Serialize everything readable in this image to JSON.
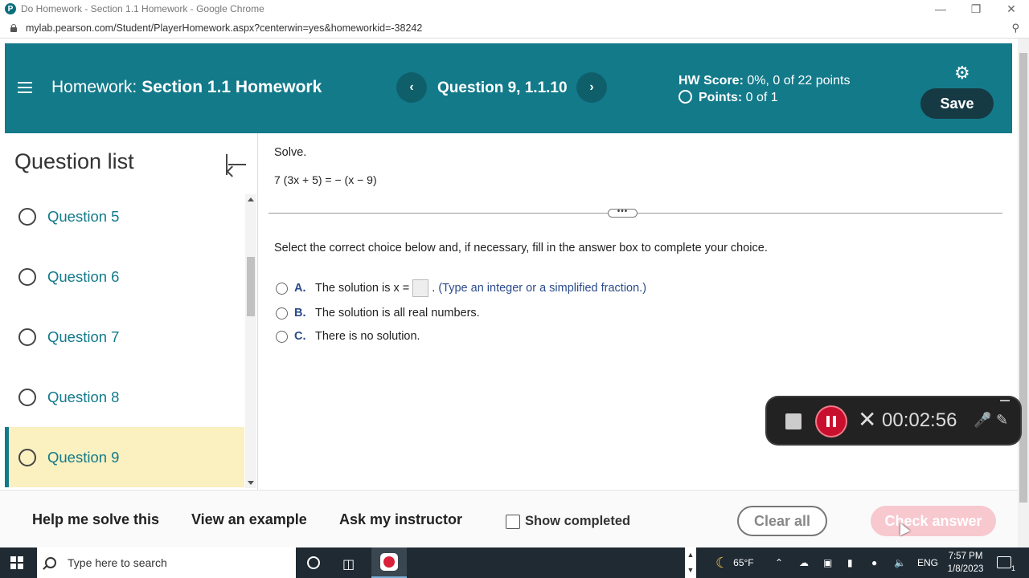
{
  "browser": {
    "window_title": "Do Homework - Section 1.1 Homework - Google Chrome",
    "url": "mylab.pearson.com/Student/PlayerHomework.aspx?centerwin=yes&homeworkid=-38242"
  },
  "header": {
    "homework_label": "Homework:",
    "homework_name": "Section 1.1 Homework",
    "question_title": "Question 9, 1.1.10",
    "score_label": "HW Score:",
    "score_value": "0%, 0 of 22 points",
    "points_label": "Points:",
    "points_value": "0 of 1",
    "save_label": "Save"
  },
  "sidebar": {
    "title": "Question list",
    "items": [
      {
        "label": "Question 5"
      },
      {
        "label": "Question 6"
      },
      {
        "label": "Question 7"
      },
      {
        "label": "Question 8"
      },
      {
        "label": "Question 9"
      }
    ],
    "active_index": 4
  },
  "question": {
    "prompt": "Solve.",
    "equation": "7 (3x + 5) = − (x − 9)",
    "instructions": "Select the correct choice below and, if necessary, fill in the answer box to complete your choice.",
    "choices": [
      {
        "letter": "A.",
        "text_before": "The solution is x =",
        "text_after": ".",
        "hint": "(Type an integer or a simplified fraction.)"
      },
      {
        "letter": "B.",
        "text": "The solution is all real numbers."
      },
      {
        "letter": "C.",
        "text": "There is no solution."
      }
    ]
  },
  "recorder": {
    "time": "00:02:56"
  },
  "footer": {
    "help_label": "Help me solve this",
    "example_label": "View an example",
    "instructor_label": "Ask my instructor",
    "show_completed_label": "Show completed",
    "clear_label": "Clear all",
    "check_label": "Check answer"
  },
  "taskbar": {
    "search_placeholder": "Type here to search",
    "weather": "65°F",
    "language": "ENG",
    "time": "7:57 PM",
    "date": "1/8/2023",
    "notification_count": "1"
  },
  "colors": {
    "header_teal": "#137a8a",
    "save_dark": "#163a44",
    "active_row": "#faf0c0",
    "check_pink": "#f8c8cf"
  }
}
